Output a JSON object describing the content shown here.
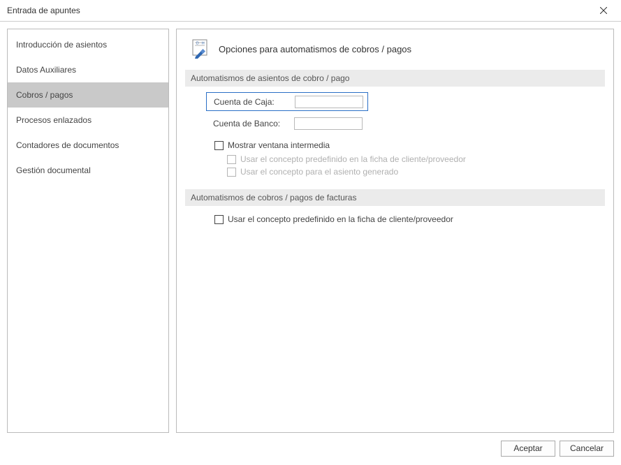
{
  "window": {
    "title": "Entrada de apuntes"
  },
  "sidebar": {
    "items": [
      {
        "label": "Introducción de asientos",
        "selected": false,
        "name": "sidebar-item-introduccion-asientos"
      },
      {
        "label": "Datos Auxiliares",
        "selected": false,
        "name": "sidebar-item-datos-auxiliares"
      },
      {
        "label": "Cobros / pagos",
        "selected": true,
        "name": "sidebar-item-cobros-pagos"
      },
      {
        "label": "Procesos enlazados",
        "selected": false,
        "name": "sidebar-item-procesos-enlazados"
      },
      {
        "label": "Contadores de documentos",
        "selected": false,
        "name": "sidebar-item-contadores-documentos"
      },
      {
        "label": "Gestión documental",
        "selected": false,
        "name": "sidebar-item-gestion-documental"
      }
    ]
  },
  "main": {
    "header_title": "Opciones para automatismos de cobros / pagos",
    "section1_title": "Automatismos de asientos de cobro / pago",
    "field_caja_label": "Cuenta de Caja:",
    "field_caja_value": "",
    "field_banco_label": "Cuenta de Banco:",
    "field_banco_value": "",
    "cb_mostrar_ventana": {
      "label": "Mostrar ventana intermedia",
      "checked": false,
      "enabled": true
    },
    "cb_concepto_ficha1": {
      "label": "Usar el concepto predefinido en la ficha de cliente/proveedor",
      "checked": false,
      "enabled": false
    },
    "cb_concepto_asiento": {
      "label": "Usar el concepto para el asiento generado",
      "checked": false,
      "enabled": false
    },
    "section2_title": "Automatismos de cobros / pagos de facturas",
    "cb_concepto_ficha2": {
      "label": "Usar el concepto predefinido en la ficha de cliente/proveedor",
      "checked": false,
      "enabled": true
    }
  },
  "footer": {
    "accept_label": "Aceptar",
    "cancel_label": "Cancelar"
  }
}
